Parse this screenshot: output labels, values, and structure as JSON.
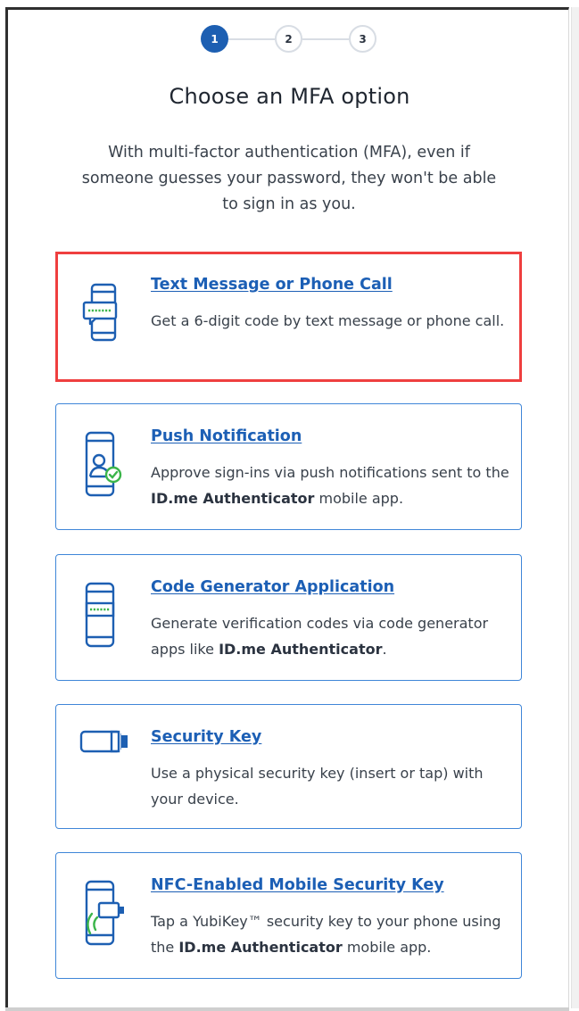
{
  "stepper": {
    "steps": [
      "1",
      "2",
      "3"
    ],
    "active": 1
  },
  "header": {
    "title": "Choose an MFA option",
    "subtitle": "With multi-factor authentication (MFA), even if someone guesses your password, they won't be able to sign in as you."
  },
  "options": [
    {
      "title": "Text Message or Phone Call",
      "desc_pre": "Get a 6-digit code by text message or phone call.",
      "desc_bold": "",
      "desc_post": "",
      "icon": "phone-message-icon",
      "selected": true
    },
    {
      "title": "Push Notification",
      "desc_pre": "Approve sign-ins via push notifications sent to the ",
      "desc_bold": "ID.me Authenticator",
      "desc_post": " mobile app.",
      "icon": "phone-user-check-icon",
      "selected": false
    },
    {
      "title": "Code Generator Application",
      "desc_pre": "Generate verification codes via code generator apps like ",
      "desc_bold": "ID.me Authenticator",
      "desc_post": ".",
      "icon": "phone-code-icon",
      "selected": false
    },
    {
      "title": "Security Key",
      "desc_pre": "Use a physical security key (insert or tap) with your device.",
      "desc_bold": "",
      "desc_post": "",
      "icon": "usb-key-icon",
      "selected": false
    },
    {
      "title": "NFC-Enabled Mobile Security Key",
      "desc_pre": "Tap a YubiKey™ security key to your phone using the ",
      "desc_bold": "ID.me Authenticator",
      "desc_post": " mobile app.",
      "icon": "phone-nfc-key-icon",
      "selected": false
    }
  ],
  "colors": {
    "accent": "#1d5fb2",
    "link": "#1c5fb5",
    "selected_border": "#ef3f3f",
    "card_border": "#3f86d8",
    "icon_green": "#3bb54a"
  }
}
